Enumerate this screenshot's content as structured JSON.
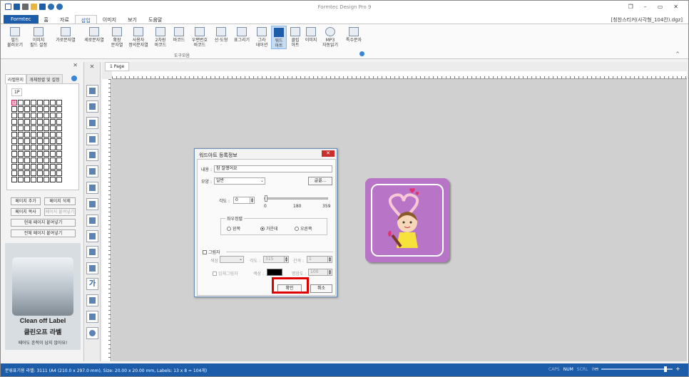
{
  "titlebar": {
    "title": "Formtec Design Pro 9",
    "minimize": "–",
    "restore": "▭",
    "maximize": "❐",
    "close": "✕"
  },
  "tabs": {
    "file": "Formtec",
    "items": [
      "홈",
      "자료",
      "삽입",
      "이미지",
      "보기",
      "도움말"
    ],
    "active": "삽입"
  },
  "document": {
    "filename": "[칭찬스티커(사각형_104칸).dgz]",
    "page_tab": "1 Page"
  },
  "ribbon": {
    "buttons": [
      "필드\n불러오기",
      "이미지\n필드 설정",
      "가로문자열",
      "세로문자열",
      "확장\n문자열",
      "사용자\n정의문자열",
      "2차원\n바코드",
      "바코드",
      "우편번호\n바코드",
      "선·도형\n·",
      "표그리기",
      "그라\n데이션",
      "워드\n아트",
      "클립\n아트",
      "이미지",
      "MP3\n자동읽기",
      "특수문자"
    ],
    "selected": "워드\n아트",
    "group_label": "도구모음",
    "collapse": "^"
  },
  "left_panel": {
    "close": "✕",
    "tabs": [
      "라벨용지",
      "개체정렬 및 설정"
    ],
    "page_tab": "1P",
    "label_first_index": "1",
    "grid_rows": 13,
    "grid_cols": 8,
    "buttons": {
      "add_page": "페이지 추가",
      "delete_page": "페이지 삭제",
      "copy_page": "페이지 복사",
      "paste_page": "페이지 붙여넣기",
      "paste_current": "현재 페이지 붙여넣기",
      "paste_all": "전체 페이지 붙여넣기"
    },
    "promo": {
      "logo_en": "Clean off Label",
      "logo_ko": "클린오프 라벨",
      "slogan": "떼어도 흔적이 남지 않아요!"
    }
  },
  "vtool": {
    "close": "✕"
  },
  "dialog": {
    "title": "워드아트 등록정보",
    "close": "✕",
    "content_label": "내용 :",
    "content_value": "참 잘했어요",
    "shape_label": "모양 :",
    "shape_value": "일반",
    "font_button": "글꼴...",
    "angle_label": "각도 :",
    "angle_value": "0",
    "slider_min": "0",
    "slider_mid": "180",
    "slider_max": "359",
    "align_caption": "좌우정렬",
    "align_options": [
      "왼쪽",
      "가운데",
      "오른쪽"
    ],
    "align_selected": "가운데",
    "shadow_label": "그림자",
    "shadow_color_label": "색상 :",
    "shadow_angle_label": "각도 :",
    "shadow_angle_value": "315",
    "shadow_gap_label": "간격 :",
    "shadow_gap_value": "1",
    "shadow3d_label": "입체그림자",
    "shadow3d_color_label": "색상 :",
    "shadow3d_opacity_label": "명암도 :",
    "shadow3d_opacity_value": "100",
    "ok": "확인",
    "cancel": "취소"
  },
  "status": {
    "text": "분류표기용 라벨: 3111 (A4 (210.0 x 297.0 mm), Size: 20.00 x 20.00 mm, Labels: 13 x 8 = 104개)",
    "caps": "CAPS",
    "num": "NUM",
    "scrl": "SCRL",
    "ins": "INS",
    "zoom_minus": "−",
    "zoom_plus": "+"
  },
  "colors": {
    "brand": "#1c5ca8",
    "sticker": "#b874c7",
    "highlight": "#e00000",
    "shadow3d_color": "#000000",
    "shadow_color": "#b0b0b0"
  }
}
